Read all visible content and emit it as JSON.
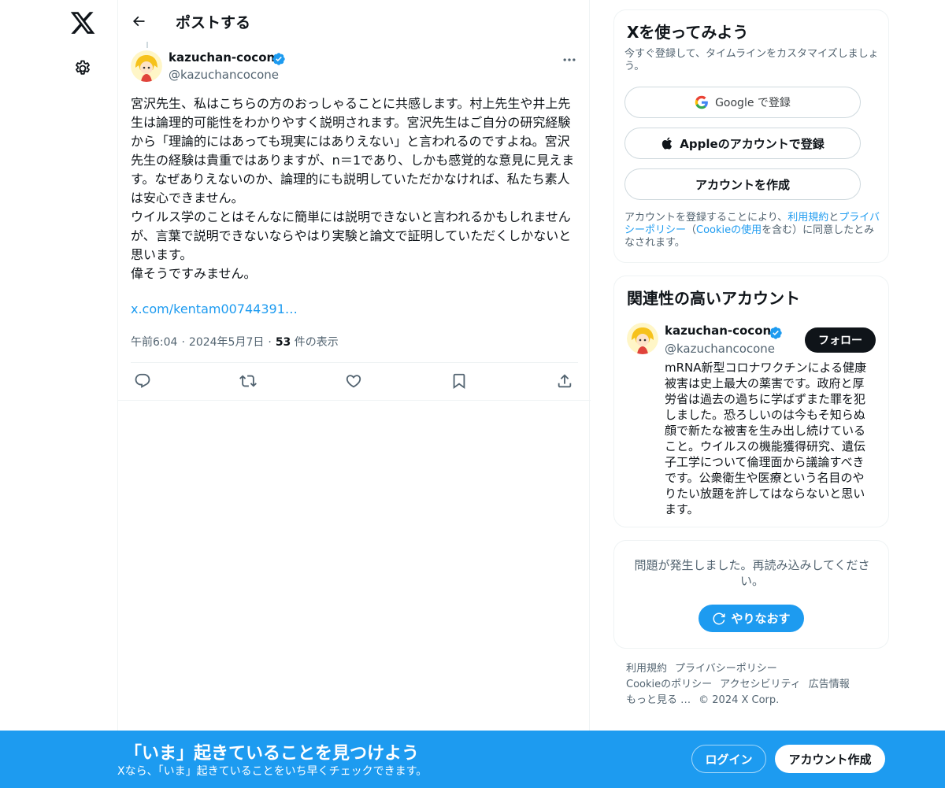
{
  "nav": {
    "logo_icon": "x-logo-icon",
    "settings_icon": "gear-icon"
  },
  "header": {
    "title": "ポストする",
    "back_icon": "arrow-left-icon"
  },
  "post": {
    "author_name": "kazuchan-cocone",
    "author_handle": "@kazuchancocone",
    "verified": true,
    "text": "宮沢先生、私はこちらの方のおっしゃることに共感します。村上先生や井上先生は論理的可能性をわかりやすく説明されます。宮沢先生はご自分の研究経験から「理論的にはあっても現実にはありえない」と言われるのですよね。宮沢先生の経験は貴重ではありますが、n＝1であり、しかも感覚的な意見に見えます。なぜありえないのか、論理的にも説明していただかなければ、私たち素人は安心できません。\nウイルス学のことはそんなに簡単には説明できないと言われるかもしれませんが、言葉で説明できないならやはり実験と論文で証明していただくしかないと思います。\n偉そうですみません。",
    "link": "x.com/kentam00744391…",
    "time": "午前6:04",
    "date": "2024年5月7日",
    "views_count": "53",
    "views_label": "件の表示",
    "actions": [
      "reply-icon",
      "repost-icon",
      "like-icon",
      "bookmark-icon",
      "share-icon"
    ]
  },
  "signup_card": {
    "title": "Xを使ってみよう",
    "subtitle": "今すぐ登録して、タイムラインをカスタマイズしましょう。",
    "google_label": "Google で登録",
    "apple_label": "Appleのアカウントで登録",
    "create_label": "アカウントを作成",
    "terms_prefix": "アカウントを登録することにより、",
    "terms_link": "利用規約",
    "terms_and": "と",
    "privacy_link": "プライバシーポリシー",
    "terms_open": "（",
    "cookie_link": "Cookieの使用",
    "terms_suffix": "を含む）に同意したとみなされます。"
  },
  "relevant_card": {
    "title": "関連性の高いアカウント",
    "name": "kazuchan-cocone",
    "handle": "@kazuchancocone",
    "follow_label": "フォロー",
    "bio": "mRNA新型コロナワクチンによる健康被害は史上最大の薬害です。政府と厚労省は過去の過ちに学ばずまた罪を犯しました。恐ろしいのは今もそ知らぬ顔で新たな被害を生み出し続けていること。ウイルスの機能獲得研究、遺伝子工学について倫理面から議論すべきです。公衆衛生や医療という名目のやりたい放題を許してはならないと思います。"
  },
  "error_card": {
    "message": "問題が発生しました。再読み込みしてください。",
    "retry_label": "やりなおす"
  },
  "footer": {
    "links": [
      "利用規約",
      "プライバシーポリシー",
      "Cookieのポリシー",
      "アクセシビリティ",
      "広告情報",
      "もっと見る …",
      "© 2024 X Corp."
    ]
  },
  "banner": {
    "title": "「いま」起きていることを見つけよう",
    "subtitle": "Xなら、「いま」起きていることをいち早くチェックできます。",
    "login_label": "ログイン",
    "signup_label": "アカウント作成"
  },
  "colors": {
    "accent": "#1d9bf0",
    "text": "#0f1419",
    "muted": "#536471"
  }
}
